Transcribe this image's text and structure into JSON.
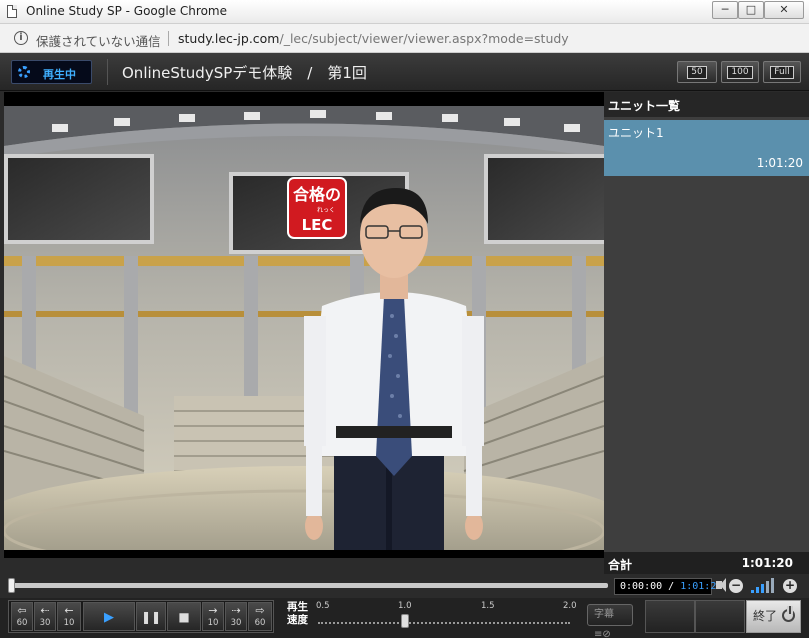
{
  "window": {
    "title": "Online Study SP - Google Chrome",
    "min": "─",
    "max": "□",
    "close": "✕"
  },
  "address": {
    "security_text": "保護されていない通信",
    "host": "study.lec-jp.com",
    "path": "/_lec/subject/viewer/viewer.aspx?mode=study"
  },
  "header": {
    "status": "再生中",
    "title": "OnlineStudySPデモ体験　/　第1回",
    "view_buttons": [
      "50",
      "100",
      "Full"
    ]
  },
  "video": {
    "logo_line1": "合格の",
    "logo_sub": "れっく",
    "logo_line2": "LEC"
  },
  "sidebar": {
    "header": "ユニット一覧",
    "units": [
      {
        "name": "ユニット1",
        "duration": "1:01:20"
      }
    ],
    "total_label": "合計",
    "total_value": "1:01:20"
  },
  "playback": {
    "current": "0:00:00",
    "divider": " / ",
    "total": "1:01:20",
    "progress": 0
  },
  "controls": {
    "rew60": "60",
    "rew30": "30",
    "rew10": "10",
    "fwd10": "10",
    "fwd30": "30",
    "fwd60": "60",
    "speed_label_1": "再生",
    "speed_label_2": "速度",
    "speed_ticks": [
      "0.5",
      "1.0",
      "1.5",
      "2.0"
    ],
    "speed_value": 1.0,
    "caption": "字幕",
    "end": "終了"
  },
  "colors": {
    "accent": "#3aa0ff",
    "unit_selected": "#5b90ad"
  }
}
